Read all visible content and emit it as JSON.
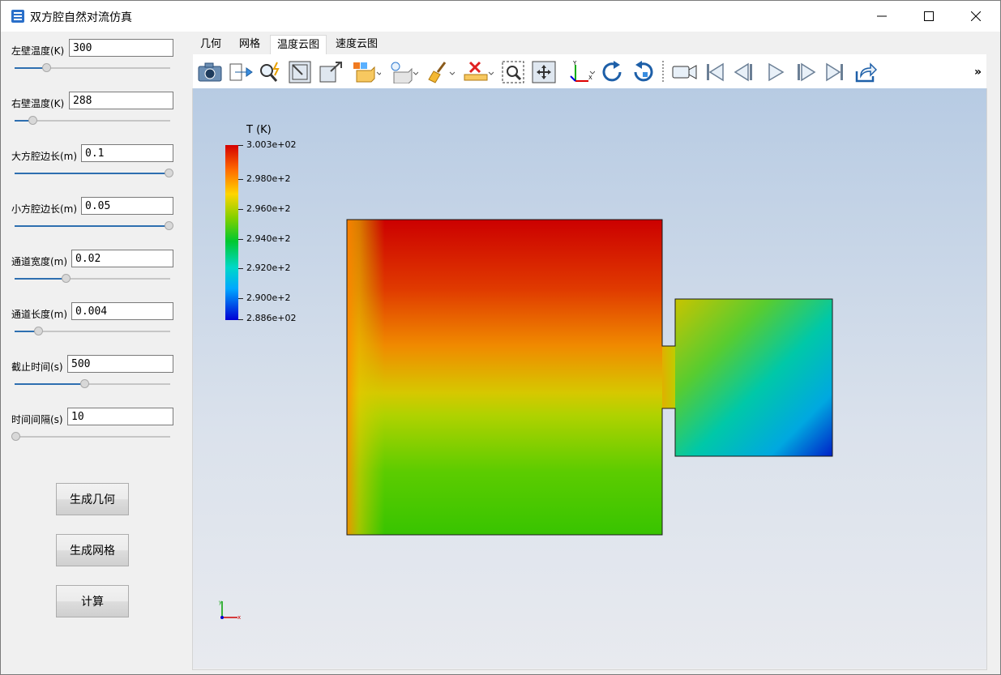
{
  "window": {
    "title": "双方腔自然对流仿真"
  },
  "params": [
    {
      "label": "左壁温度(K)",
      "value": "300",
      "slider": 0.2
    },
    {
      "label": "右壁温度(K)",
      "value": "288",
      "slider": 0.11
    },
    {
      "label": "大方腔边长(m)",
      "value": "0.1",
      "slider": 1.0
    },
    {
      "label": "小方腔边长(m)",
      "value": "0.05",
      "slider": 1.0
    },
    {
      "label": "通道宽度(m)",
      "value": "0.02",
      "slider": 0.33
    },
    {
      "label": "通道长度(m)",
      "value": "0.004",
      "slider": 0.15
    },
    {
      "label": "截止时间(s)",
      "value": "500",
      "slider": 0.45
    },
    {
      "label": "时间间隔(s)",
      "value": "10",
      "slider": 0.0
    }
  ],
  "actions": {
    "generate_geometry": "生成几何",
    "generate_mesh": "生成网格",
    "compute": "计算"
  },
  "tabs": [
    "几何",
    "网格",
    "温度云图",
    "速度云图"
  ],
  "active_tab": "温度云图",
  "toolbar": {
    "icons": [
      "camera-icon",
      "export-icon",
      "probe-icon",
      "fit-view-icon",
      "reset-view-icon",
      "shaded-surface-icon",
      "light-icon",
      "clear-icon",
      "delete-icon",
      "zoom-box-icon",
      "pan-icon",
      "axes-icon",
      "rotate-cw-icon",
      "rotate-ccw-icon",
      "record-video-icon",
      "first-frame-icon",
      "previous-frame-icon",
      "play-icon",
      "next-frame-icon",
      "last-frame-icon",
      "share-icon"
    ],
    "overflow": "»"
  },
  "legend": {
    "title": "T (K)",
    "labels": [
      "3.003e+02",
      "2.980e+2",
      "2.960e+2",
      "2.940e+2",
      "2.920e+2",
      "2.900e+2",
      "2.886e+02"
    ],
    "colors": {
      "hot": "#d40000",
      "warm": "#ffd500",
      "mid": "#00c830",
      "cool": "#00d8c8",
      "cold": "#0000d4"
    }
  },
  "axis_triad": {
    "x": "x",
    "y": "y"
  }
}
